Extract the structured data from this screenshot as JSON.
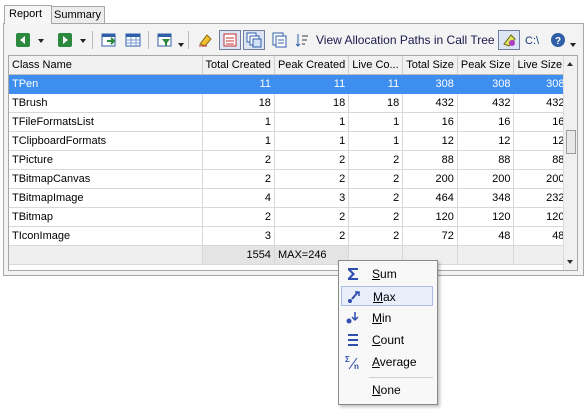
{
  "tabs": [
    {
      "label": "Report",
      "active": true
    },
    {
      "label": "Summary",
      "active": false
    }
  ],
  "toolbar": {
    "allocation_paths_label": "View Allocation Paths in Call Tree",
    "icons": [
      "back-icon",
      "forward-icon",
      "export-icon",
      "grid-icon",
      "filter-icon",
      "clear-icon",
      "compare-icon",
      "stack-icon",
      "list-icon",
      "sort-icon",
      "paths-icon",
      "c-drive-icon",
      "help-icon"
    ]
  },
  "grid": {
    "columns": [
      "Class Name",
      "Total Created",
      "Peak Created",
      "Live Co...",
      "Total Size",
      "Peak Size",
      "Live Size"
    ],
    "rows": [
      {
        "cells": [
          "TPen",
          "11",
          "11",
          "11",
          "308",
          "308",
          "308"
        ],
        "selected": true
      },
      {
        "cells": [
          "TBrush",
          "18",
          "18",
          "18",
          "432",
          "432",
          "432"
        ]
      },
      {
        "cells": [
          "TFileFormatsList",
          "1",
          "1",
          "1",
          "16",
          "16",
          "16"
        ]
      },
      {
        "cells": [
          "TClipboardFormats",
          "1",
          "1",
          "1",
          "12",
          "12",
          "12"
        ]
      },
      {
        "cells": [
          "TPicture",
          "2",
          "2",
          "2",
          "88",
          "88",
          "88"
        ]
      },
      {
        "cells": [
          "TBitmapCanvas",
          "2",
          "2",
          "2",
          "200",
          "200",
          "200"
        ]
      },
      {
        "cells": [
          "TBitmapImage",
          "4",
          "3",
          "2",
          "464",
          "348",
          "232"
        ]
      },
      {
        "cells": [
          "TBitmap",
          "2",
          "2",
          "2",
          "120",
          "120",
          "120"
        ]
      },
      {
        "cells": [
          "TIconImage",
          "3",
          "2",
          "2",
          "72",
          "48",
          "48"
        ]
      }
    ],
    "footer": {
      "total_created": "1554",
      "peak_created": "MAX=246"
    }
  },
  "menu": {
    "items": [
      {
        "label": "Sum",
        "icon": "sigma-icon"
      },
      {
        "label": "Max",
        "icon": "max-icon",
        "highlighted": true
      },
      {
        "label": "Min",
        "icon": "min-icon"
      },
      {
        "label": "Count",
        "icon": "count-icon"
      },
      {
        "label": "Average",
        "icon": "average-icon"
      },
      {
        "label": "None"
      }
    ]
  },
  "colors": {
    "selection": "#3e8eef",
    "menu_highlight": "#e8eefa"
  }
}
